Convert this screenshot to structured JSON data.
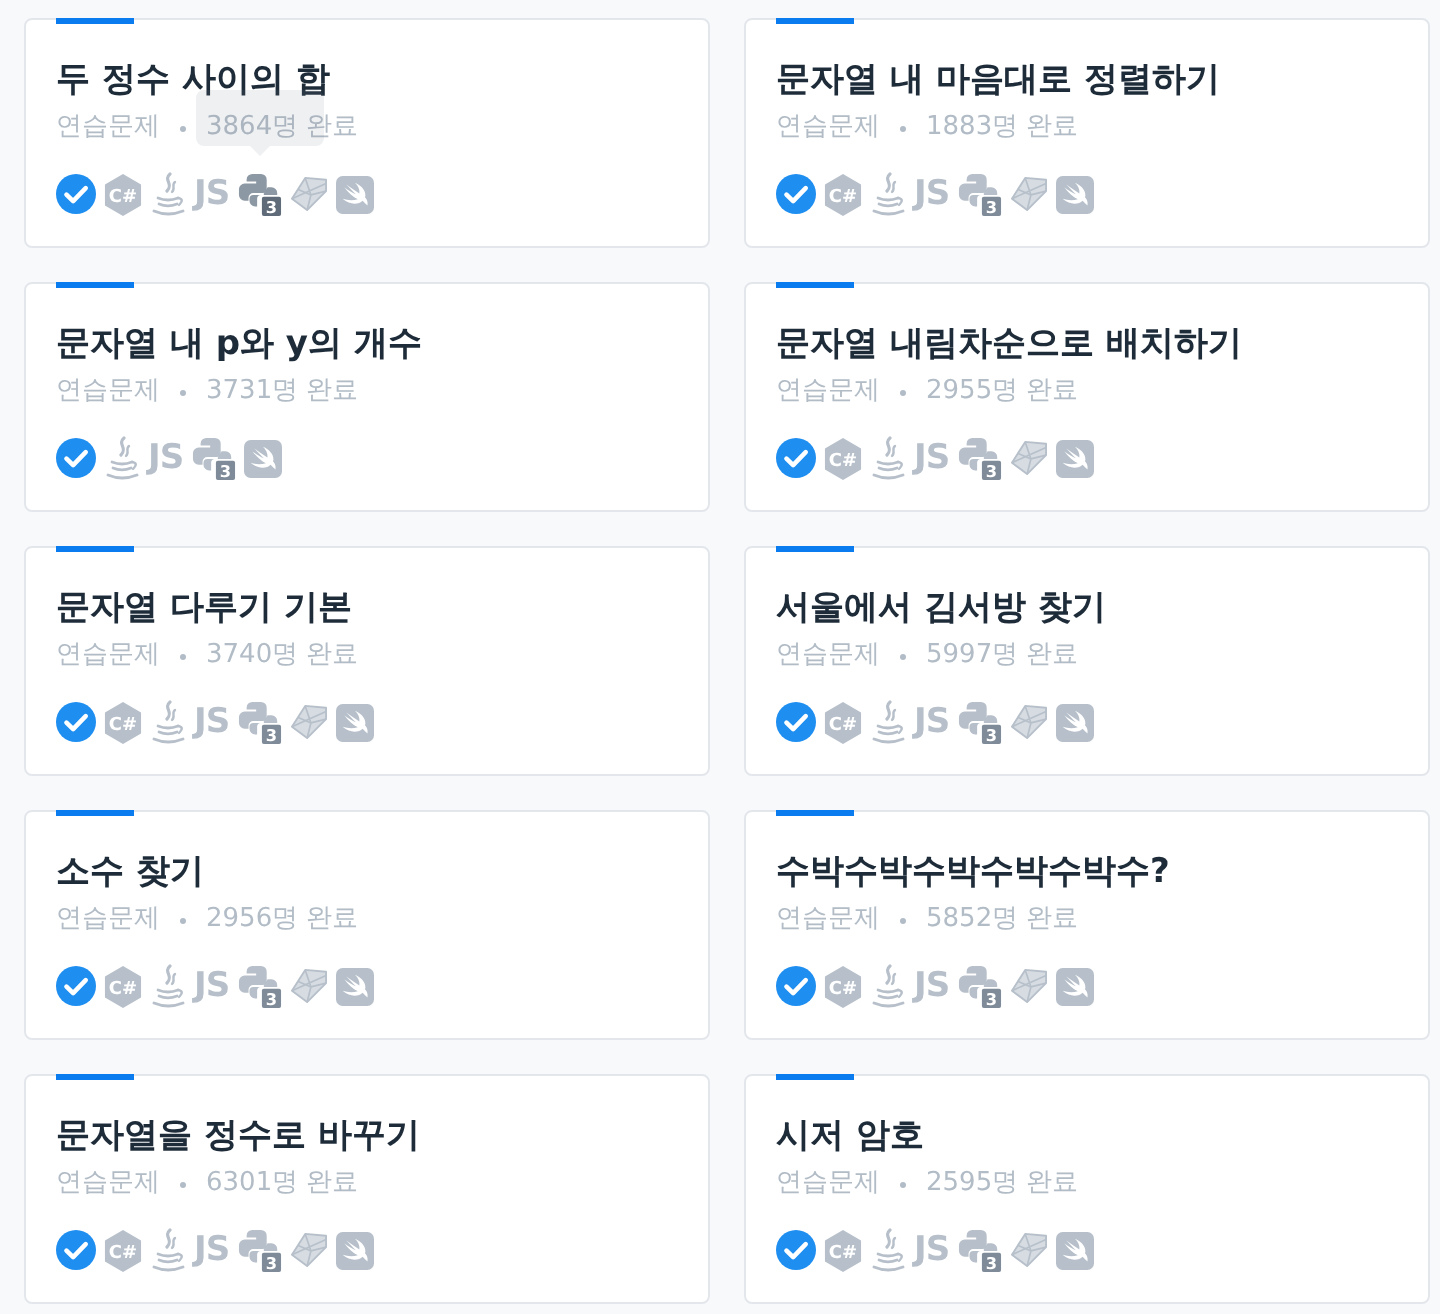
{
  "cards": [
    {
      "title": "두 정수 사이의 합",
      "category": "연습문제",
      "completed": "3864명 완료",
      "solved": true,
      "languages": [
        {
          "kind": "csharp",
          "label": "C#",
          "hovered": false
        },
        {
          "kind": "java",
          "hovered": false
        },
        {
          "kind": "javascript",
          "label": "JS",
          "hovered": false
        },
        {
          "kind": "python",
          "label": "3",
          "hovered": true
        },
        {
          "kind": "ruby",
          "hovered": false
        },
        {
          "kind": "swift",
          "hovered": false
        }
      ]
    },
    {
      "title": "문자열 내 마음대로 정렬하기",
      "category": "연습문제",
      "completed": "1883명 완료",
      "solved": true,
      "languages": [
        {
          "kind": "csharp",
          "label": "C#",
          "hovered": false
        },
        {
          "kind": "java",
          "hovered": false
        },
        {
          "kind": "javascript",
          "label": "JS",
          "hovered": false
        },
        {
          "kind": "python",
          "label": "3",
          "hovered": false
        },
        {
          "kind": "ruby",
          "hovered": false
        },
        {
          "kind": "swift",
          "hovered": false
        }
      ]
    },
    {
      "title": "문자열 내 p와 y의 개수",
      "category": "연습문제",
      "completed": "3731명 완료",
      "solved": true,
      "languages": [
        {
          "kind": "java",
          "hovered": false
        },
        {
          "kind": "javascript",
          "label": "JS",
          "hovered": false
        },
        {
          "kind": "python",
          "label": "3",
          "hovered": false
        },
        {
          "kind": "swift",
          "hovered": false
        }
      ]
    },
    {
      "title": "문자열 내림차순으로 배치하기",
      "category": "연습문제",
      "completed": "2955명 완료",
      "solved": true,
      "languages": [
        {
          "kind": "csharp",
          "label": "C#",
          "hovered": false
        },
        {
          "kind": "java",
          "hovered": false
        },
        {
          "kind": "javascript",
          "label": "JS",
          "hovered": false
        },
        {
          "kind": "python",
          "label": "3",
          "hovered": false
        },
        {
          "kind": "ruby",
          "hovered": false
        },
        {
          "kind": "swift",
          "hovered": false
        }
      ]
    },
    {
      "title": "문자열 다루기 기본",
      "category": "연습문제",
      "completed": "3740명 완료",
      "solved": true,
      "languages": [
        {
          "kind": "csharp",
          "label": "C#",
          "hovered": false
        },
        {
          "kind": "java",
          "hovered": false
        },
        {
          "kind": "javascript",
          "label": "JS",
          "hovered": false
        },
        {
          "kind": "python",
          "label": "3",
          "hovered": false
        },
        {
          "kind": "ruby",
          "hovered": false
        },
        {
          "kind": "swift",
          "hovered": false
        }
      ]
    },
    {
      "title": "서울에서 김서방 찾기",
      "category": "연습문제",
      "completed": "5997명 완료",
      "solved": true,
      "languages": [
        {
          "kind": "csharp",
          "label": "C#",
          "hovered": false
        },
        {
          "kind": "java",
          "hovered": false
        },
        {
          "kind": "javascript",
          "label": "JS",
          "hovered": false
        },
        {
          "kind": "python",
          "label": "3",
          "hovered": false
        },
        {
          "kind": "ruby",
          "hovered": false
        },
        {
          "kind": "swift",
          "hovered": false
        }
      ]
    },
    {
      "title": "소수 찾기",
      "category": "연습문제",
      "completed": "2956명 완료",
      "solved": true,
      "languages": [
        {
          "kind": "csharp",
          "label": "C#",
          "hovered": false
        },
        {
          "kind": "java",
          "hovered": false
        },
        {
          "kind": "javascript",
          "label": "JS",
          "hovered": false
        },
        {
          "kind": "python",
          "label": "3",
          "hovered": false
        },
        {
          "kind": "ruby",
          "hovered": false
        },
        {
          "kind": "swift",
          "hovered": false
        }
      ]
    },
    {
      "title": "수박수박수박수박수박수?",
      "category": "연습문제",
      "completed": "5852명 완료",
      "solved": true,
      "languages": [
        {
          "kind": "csharp",
          "label": "C#",
          "hovered": false
        },
        {
          "kind": "java",
          "hovered": false
        },
        {
          "kind": "javascript",
          "label": "JS",
          "hovered": false
        },
        {
          "kind": "python",
          "label": "3",
          "hovered": false
        },
        {
          "kind": "ruby",
          "hovered": false
        },
        {
          "kind": "swift",
          "hovered": false
        }
      ]
    },
    {
      "title": "문자열을 정수로 바꾸기",
      "category": "연습문제",
      "completed": "6301명 완료",
      "solved": true,
      "languages": [
        {
          "kind": "csharp",
          "label": "C#",
          "hovered": false
        },
        {
          "kind": "java",
          "hovered": false
        },
        {
          "kind": "javascript",
          "label": "JS",
          "hovered": false
        },
        {
          "kind": "python",
          "label": "3",
          "hovered": false
        },
        {
          "kind": "ruby",
          "hovered": false
        },
        {
          "kind": "swift",
          "hovered": false
        }
      ]
    },
    {
      "title": "시저 암호",
      "category": "연습문제",
      "completed": "2595명 완료",
      "solved": true,
      "languages": [
        {
          "kind": "csharp",
          "label": "C#",
          "hovered": false
        },
        {
          "kind": "java",
          "hovered": false
        },
        {
          "kind": "javascript",
          "label": "JS",
          "hovered": false
        },
        {
          "kind": "python",
          "label": "3",
          "hovered": false
        },
        {
          "kind": "ruby",
          "hovered": false
        },
        {
          "kind": "swift",
          "hovered": false
        }
      ]
    }
  ]
}
